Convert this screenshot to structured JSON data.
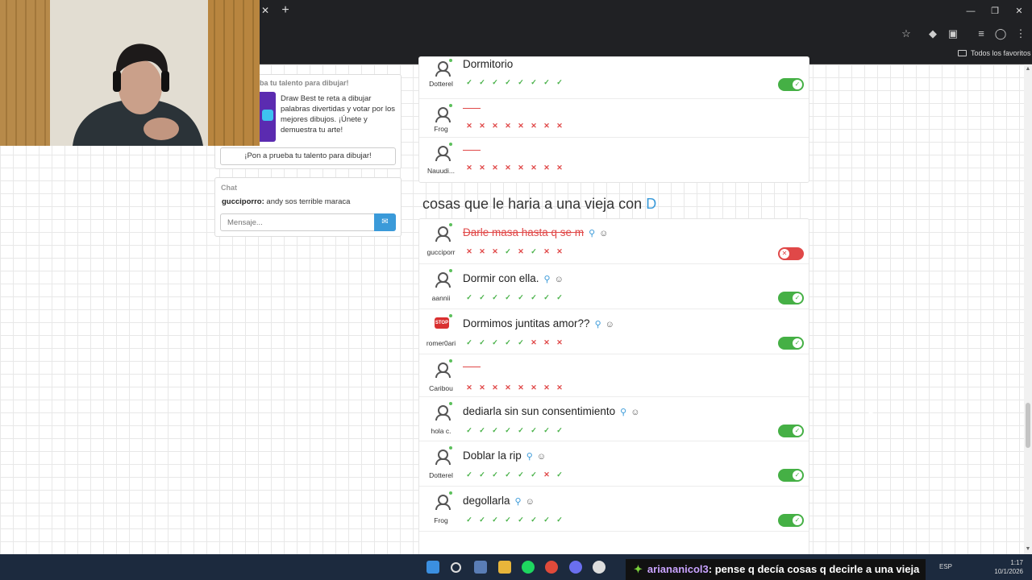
{
  "browser": {
    "bookmarks_folder": "Todos los favoritos"
  },
  "sidebar": {
    "promo_title": "ba tu talento para dibujar!",
    "promo_text": "Draw Best te reta a dibujar palabras divertidas y votar por los mejores dibujos. ¡Únete y demuestra tu arte!",
    "promo_button": "¡Pon a prueba tu talento para dibujar!",
    "chat_title": "Chat",
    "chat_user": "gucciporro:",
    "chat_text": "andy sos terrible maraca",
    "chat_placeholder": "Mensaje..."
  },
  "top_list": {
    "partial_answer": "Dormitorio",
    "rows": [
      {
        "user": "Dotterel",
        "votes": [
          "ok",
          "ok",
          "ok",
          "ok",
          "ok",
          "ok",
          "ok",
          "ok"
        ],
        "toggle": "on"
      },
      {
        "user": "Frog",
        "votes": [
          "no",
          "no",
          "no",
          "no",
          "no",
          "no",
          "no",
          "no"
        ]
      },
      {
        "user": "Nauudi...",
        "votes": [
          "no",
          "no",
          "no",
          "no",
          "no",
          "no",
          "no",
          "no"
        ]
      }
    ]
  },
  "section": {
    "title": "cosas que le haria a una vieja con",
    "letter": "D"
  },
  "answers": [
    {
      "user": "gucciporr",
      "text": "Darle masa hasta q se m",
      "struck": true,
      "votes": [
        "no",
        "no",
        "no",
        "ok",
        "no",
        "ok",
        "no",
        "no"
      ],
      "toggle": "off"
    },
    {
      "user": "aannii",
      "text": "Dormir con ella.",
      "votes": [
        "ok",
        "ok",
        "ok",
        "ok",
        "ok",
        "ok",
        "ok",
        "ok"
      ],
      "toggle": "on"
    },
    {
      "user": "romer0ari",
      "text": "Dormimos juntitas amor??",
      "votes": [
        "ok",
        "ok",
        "ok",
        "ok",
        "ok",
        "no",
        "no",
        "no"
      ],
      "toggle": "on"
    },
    {
      "user": "Caribou",
      "text": "",
      "votes": [
        "no",
        "no",
        "no",
        "no",
        "no",
        "no",
        "no",
        "no"
      ]
    },
    {
      "user": "hola c.",
      "text": "dediarla sin sun consentimiento",
      "votes": [
        "ok",
        "ok",
        "ok",
        "ok",
        "ok",
        "ok",
        "ok",
        "ok"
      ],
      "toggle": "on"
    },
    {
      "user": "Dotterel",
      "text": "Doblar la rip",
      "votes": [
        "ok",
        "ok",
        "ok",
        "ok",
        "ok",
        "ok",
        "no",
        "ok"
      ],
      "toggle": "on"
    },
    {
      "user": "Frog",
      "text": "degollarla",
      "votes": [
        "ok",
        "ok",
        "ok",
        "ok",
        "ok",
        "ok",
        "ok",
        "ok"
      ],
      "toggle": "on"
    }
  ],
  "overlay": {
    "name": "ariananicol3",
    "text": ": pense q decía cosas q decirle a una vieja"
  },
  "taskbar": {
    "lang": "ESP",
    "time": "1:17",
    "date": "10/1/2026"
  }
}
